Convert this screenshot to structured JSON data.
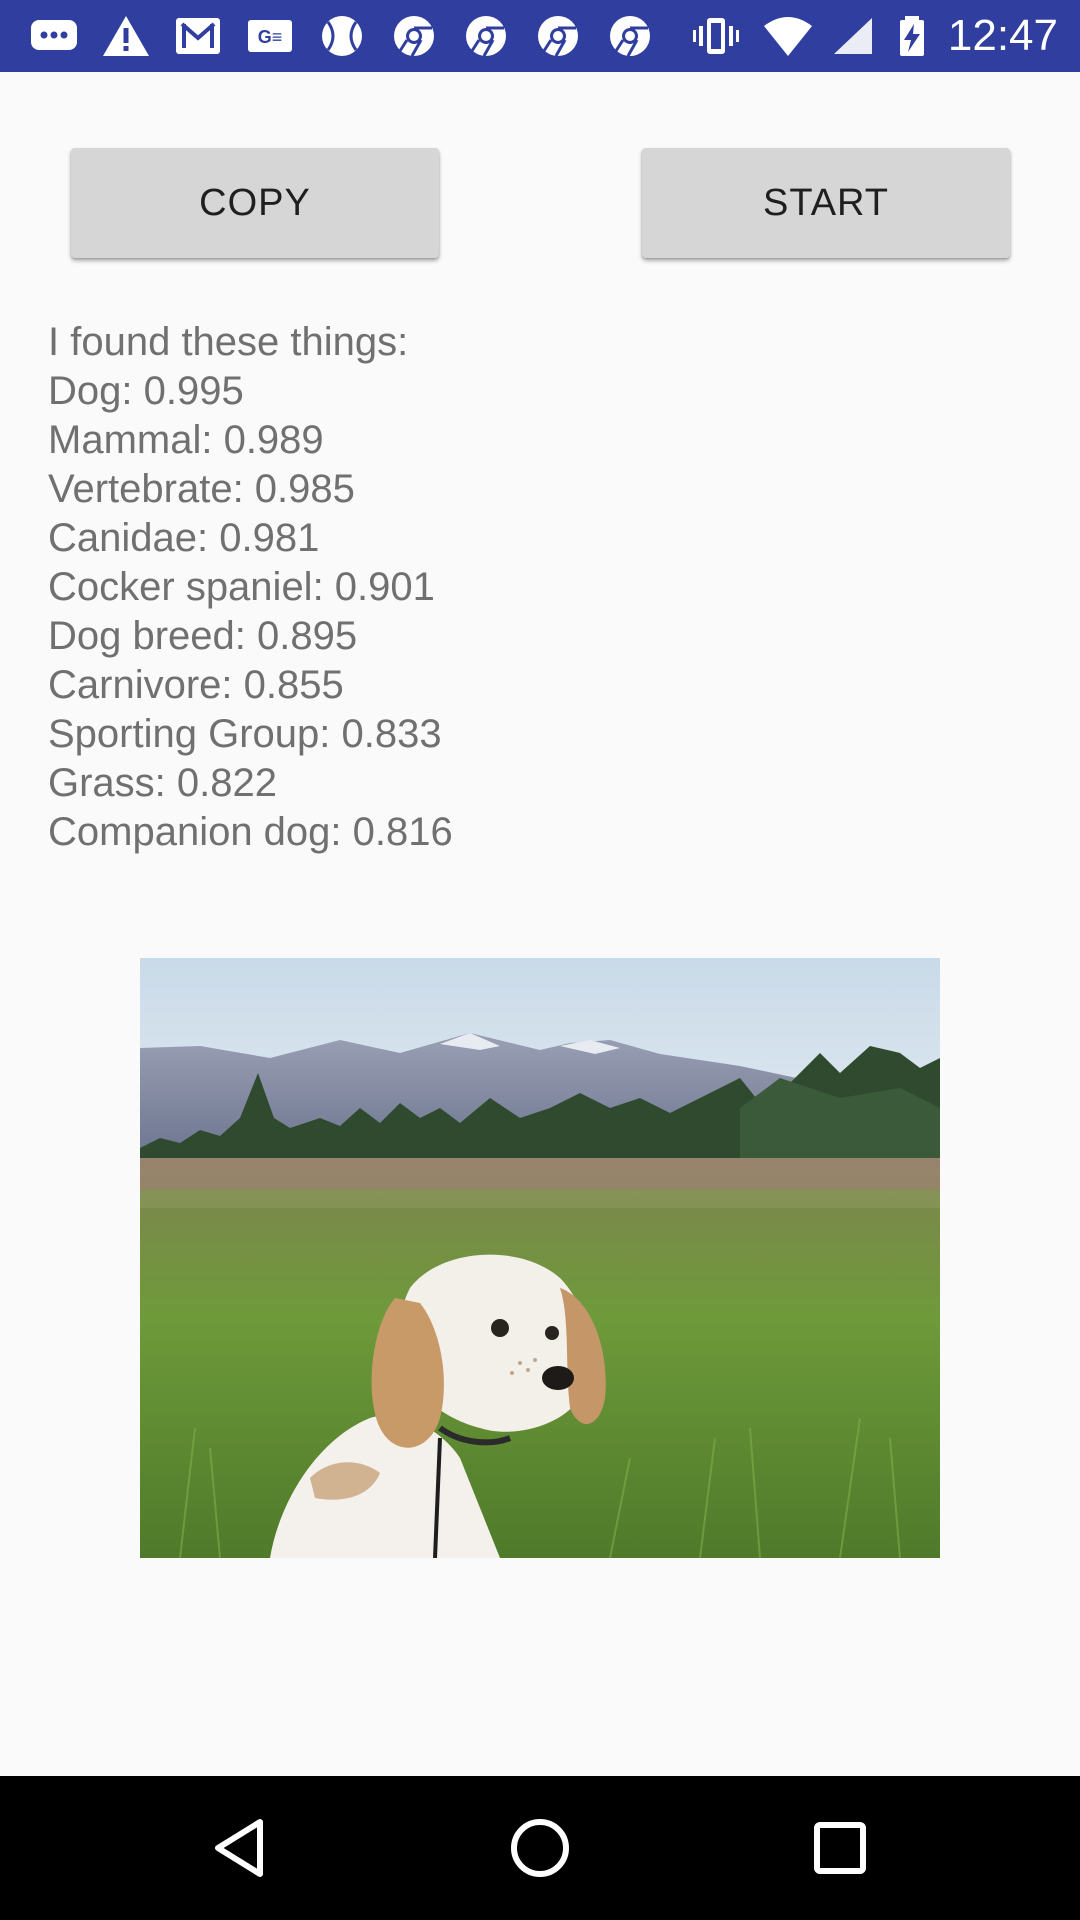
{
  "status_bar": {
    "time": "12:47",
    "background": "#303f9f",
    "icons": [
      "message-icon",
      "warning-icon",
      "gmail-icon",
      "ge-icon",
      "baseball-icon",
      "chrome-icon",
      "chrome-icon",
      "chrome-icon",
      "chrome-icon",
      "vibrate-icon",
      "wifi-icon",
      "signal-icon",
      "battery-charging-icon"
    ]
  },
  "buttons": {
    "copy_label": "COPY",
    "start_label": "START"
  },
  "results": {
    "header": "I found these things:",
    "labels": [
      "Dog: 0.995",
      "Mammal: 0.989",
      "Vertebrate: 0.985",
      "Canidae: 0.981",
      "Cocker spaniel: 0.901",
      "Dog breed: 0.895",
      "Carnivore: 0.855",
      "Sporting Group: 0.833",
      "Grass: 0.822",
      "Companion dog: 0.816"
    ]
  },
  "image": {
    "description_icon": "dog-photo"
  },
  "nav_bar": {
    "icons": [
      "back-icon",
      "home-icon",
      "recents-icon"
    ]
  }
}
